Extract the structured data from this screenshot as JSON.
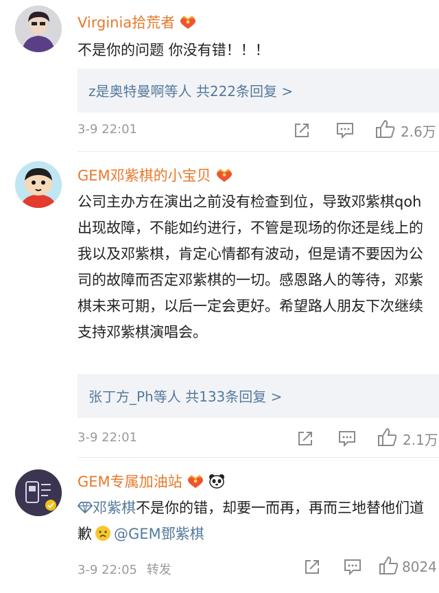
{
  "comments": [
    {
      "username": "Virginia拾荒者",
      "badge_icon": "vip-heart-crown-icon",
      "text": "不是你的问题 你没有错！！！",
      "replies": "z是奥特曼啊等人  共222条回复 >",
      "time": "3-9 22:01",
      "likes": "2.6万"
    },
    {
      "username": "GEM邓紫棋的小宝贝",
      "badge_icon": "vip-heart-crown-icon",
      "text": "公司主办方在演出之前没有检查到位，导致邓紫棋qoh出现故障，不能如约进行，不管是现场的你还是线上的我以及邓紫棋，肯定心情都有波动，但是请不要因为公司的故障而否定邓紫棋的一切。感恩路人的等待，邓紫棋未来可期，以后一定会更好。希望路人朋友下次继续支持邓紫棋演唱会。",
      "replies": "张丁方_Ph等人  共133条回复 >",
      "time": "3-9 22:01",
      "likes": "2.1万"
    },
    {
      "username": "GEM专属加油站",
      "badge_icon": "vip-heart-crown-icon",
      "extra_badge_icon": "panda-icon",
      "super_topic": "邓紫棋",
      "text": "不是你的错，却要一而再，再而三地替他们道歉",
      "emoji": "sad-face-icon",
      "mention": "@GEM鄧紫棋",
      "time": "3-9 22:05",
      "repost": "转发",
      "likes": "8024"
    }
  ],
  "colors": {
    "username": "#e8782b",
    "link": "#54799b",
    "meta": "#9a9a9a",
    "reply_bg": "#f2f3f7"
  }
}
